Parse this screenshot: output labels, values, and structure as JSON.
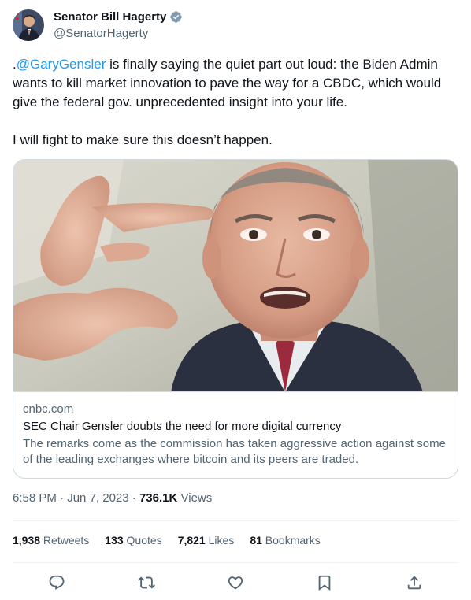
{
  "author": {
    "display_name": "Senator Bill Hagerty",
    "handle": "@SenatorHagerty",
    "verified": true
  },
  "tweet": {
    "prefix": ".",
    "mention": "@GaryGensler",
    "text_1": " is finally saying the quiet part out loud: the Biden Admin wants to kill market innovation to pave the way for a CBDC, which would give the federal gov. unprecedented insight into your life.",
    "text_2": "I will fight to make sure this doesn’t happen."
  },
  "card": {
    "domain": "cnbc.com",
    "title": "SEC Chair Gensler doubts the need for more digital currency",
    "description": "The remarks come as the commission has taken aggressive action against some of the leading exchanges where bitcoin and its peers are traded."
  },
  "meta": {
    "time": "6:58 PM",
    "separator": " · ",
    "date": "Jun 7, 2023",
    "views_count": "736.1K",
    "views_label": " Views"
  },
  "stats": {
    "retweets_count": "1,938",
    "retweets_label": " Retweets",
    "quotes_count": "133",
    "quotes_label": " Quotes",
    "likes_count": "7,821",
    "likes_label": " Likes",
    "bookmarks_count": "81",
    "bookmarks_label": " Bookmarks"
  },
  "colors": {
    "accent": "#1d9bf0",
    "text": "#0f1419",
    "secondary": "#536471",
    "border": "#cfd9de"
  },
  "icons": [
    "verified-badge-icon",
    "reply-icon",
    "retweet-icon",
    "like-icon",
    "bookmark-icon",
    "share-icon"
  ]
}
